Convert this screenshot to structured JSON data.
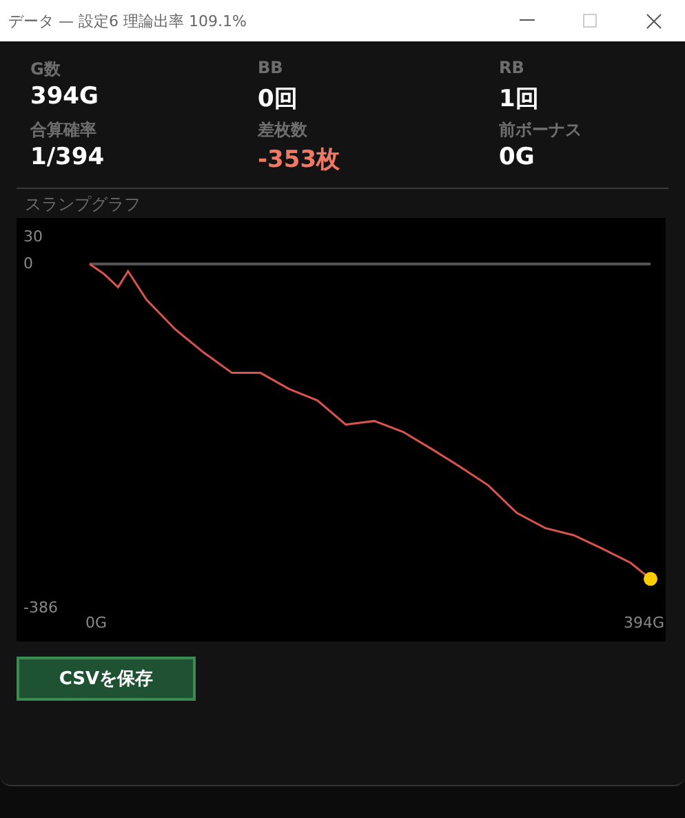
{
  "window": {
    "title": "データ — 設定6  理論出率 109.1%"
  },
  "stats": [
    {
      "label": "G数",
      "value": "394G",
      "negative": false
    },
    {
      "label": "BB",
      "value": "0回",
      "negative": false
    },
    {
      "label": "RB",
      "value": "1回",
      "negative": false
    },
    {
      "label": "合算確率",
      "value": "1/394",
      "negative": false
    },
    {
      "label": "差枚数",
      "value": "-353枚",
      "negative": true
    },
    {
      "label": "前ボーナス",
      "value": "0G",
      "negative": false
    }
  ],
  "graph": {
    "title": "スランプグラフ",
    "chart_data": {
      "type": "line",
      "x": [
        0,
        10,
        20,
        27,
        40,
        60,
        80,
        100,
        120,
        140,
        160,
        180,
        200,
        220,
        240,
        260,
        280,
        300,
        320,
        340,
        360,
        380,
        394
      ],
      "series": [
        {
          "color": "#d9534f",
          "values": [
            0,
            -11,
            -26,
            -8,
            -40,
            -73,
            -99,
            -122,
            -122,
            -140,
            -153,
            -180,
            -176,
            -188,
            -207,
            -227,
            -248,
            -279,
            -296,
            -304,
            -319,
            -335,
            -353
          ]
        }
      ],
      "xlim": [
        0,
        394
      ],
      "ylim": [
        -386,
        30
      ],
      "yticks": [
        30,
        0,
        -386
      ],
      "xticks": [
        {
          "value": 0,
          "label": "0G"
        },
        {
          "value": 394,
          "label": "394G"
        }
      ]
    }
  },
  "buttons": [
    {
      "label": "CSVを保存"
    }
  ]
}
